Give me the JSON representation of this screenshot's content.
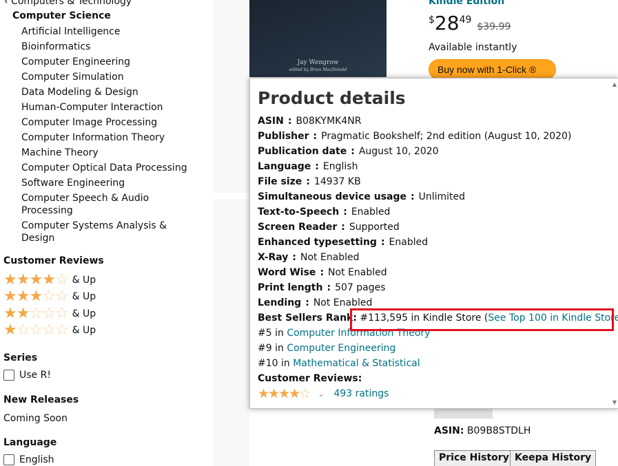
{
  "sidebar": {
    "parent_category": "‹ Computers & Technology",
    "current_category": "Computer Science",
    "subcategories": [
      "Artificial Intelligence",
      "Bioinformatics",
      "Computer Engineering",
      "Computer Simulation",
      "Data Modeling & Design",
      "Human-Computer Interaction",
      "Computer Image Processing",
      "Computer Information Theory",
      "Machine Theory",
      "Computer Optical Data Processing",
      "Software Engineering",
      "Computer Speech & Audio Processing",
      "Computer Systems Analysis & Design"
    ],
    "customer_reviews_heading": "Customer Reviews",
    "and_up": "& Up",
    "star_filters": [
      4,
      3,
      2,
      1
    ],
    "series_heading": "Series",
    "series_option": "Use R!",
    "new_releases_heading": "New Releases",
    "coming_soon": "Coming Soon",
    "language_heading": "Language",
    "language_option": "English"
  },
  "cover": {
    "author": "Jay Wengrow",
    "editor": "edited by Brian MacDonald"
  },
  "buybox": {
    "format": "Kindle Edition",
    "price_symbol": "$",
    "price_whole": "28",
    "price_fraction": "49",
    "list_price": "$39.99",
    "availability": "Available instantly",
    "buy_button": "Buy now with 1-Click ®"
  },
  "below": {
    "asin_label": "ASIN:",
    "asin_value": "B09B8STDLH",
    "price_history_button": "Price History",
    "keepa_history_button": "Keepa History"
  },
  "popover": {
    "title": "Product details",
    "rows": [
      {
        "key": "ASIN",
        "value": "B08KYMK4NR"
      },
      {
        "key": "Publisher",
        "value": "Pragmatic Bookshelf; 2nd edition (August 10, 2020)"
      },
      {
        "key": "Publication date",
        "value": "August 10, 2020"
      },
      {
        "key": "Language",
        "value": "English"
      },
      {
        "key": "File size",
        "value": "14937 KB"
      },
      {
        "key": "Simultaneous device usage",
        "value": "Unlimited"
      },
      {
        "key": "Text-to-Speech",
        "value": "Enabled"
      },
      {
        "key": "Screen Reader",
        "value": "Supported"
      },
      {
        "key": "Enhanced typesetting",
        "value": "Enabled"
      },
      {
        "key": "X-Ray",
        "value": "Not Enabled"
      },
      {
        "key": "Word Wise",
        "value": "Not Enabled"
      },
      {
        "key": "Print length",
        "value": "507 pages"
      },
      {
        "key": "Lending",
        "value": "Not Enabled"
      }
    ],
    "best_sellers_label": "Best Sellers Rank:",
    "best_sellers_value": "#113,595 in Kindle Store (",
    "top100_link": "See Top 100 in Kindle Store",
    "close_paren": ")",
    "sub_ranks": [
      {
        "rank": "#5 in",
        "category": "Computer Information Theory"
      },
      {
        "rank": "#9 in",
        "category": "Computer Engineering"
      },
      {
        "rank": "#10 in",
        "category": "Mathematical & Statistical"
      }
    ],
    "customer_reviews_label": "Customer Reviews:",
    "rating_stars": 4.5,
    "ratings_link": "493 ratings"
  },
  "colors": {
    "link": "#007185",
    "star": "#f3a847",
    "buy_button": "#ffa41c",
    "highlight": "#e3101e"
  }
}
